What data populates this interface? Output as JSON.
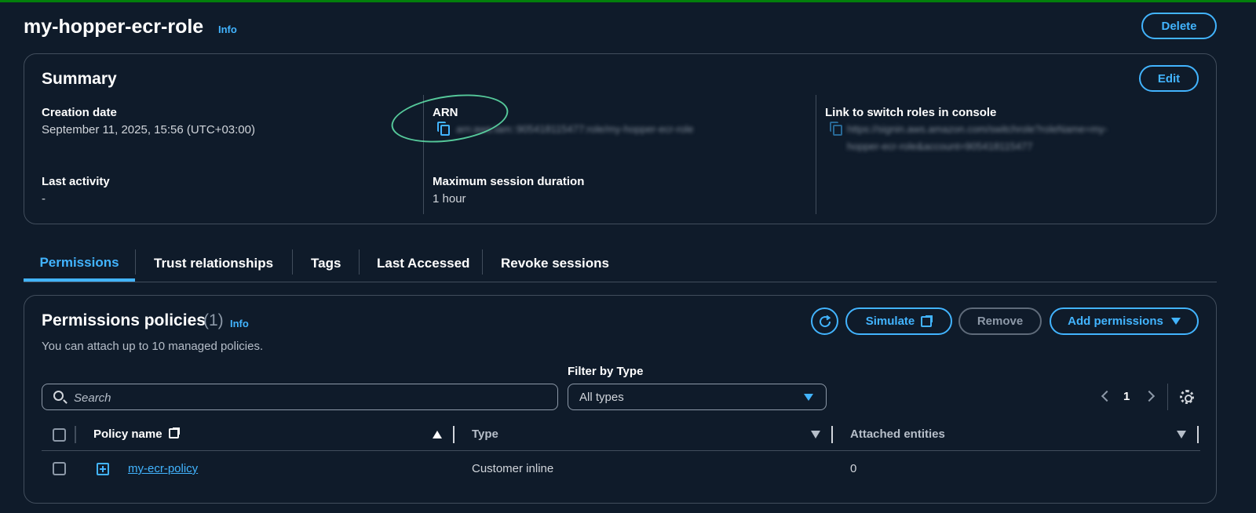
{
  "role": {
    "name": "my-hopper-ecr-role",
    "info": "Info",
    "delete_label": "Delete"
  },
  "summary": {
    "title": "Summary",
    "edit_label": "Edit",
    "creation_date_label": "Creation date",
    "creation_date_value": "September 11, 2025, 15:56 (UTC+03:00)",
    "last_activity_label": "Last activity",
    "last_activity_value": "-",
    "arn_label": "ARN",
    "arn_value": "arn:aws:iam::905418115477:role/my-hopper-ecr-role",
    "max_session_label": "Maximum session duration",
    "max_session_value": "1 hour",
    "switch_link_label": "Link to switch roles in console",
    "switch_link_line1": "https://signin.aws.amazon.com/switchrole?roleName=my-",
    "switch_link_line2": "hopper-ecr-role&account=905418115477"
  },
  "tabs": [
    {
      "label": "Permissions"
    },
    {
      "label": "Trust relationships"
    },
    {
      "label": "Tags"
    },
    {
      "label": "Last Accessed"
    },
    {
      "label": "Revoke sessions"
    }
  ],
  "policies": {
    "title": "Permissions policies",
    "count": "(1)",
    "info": "Info",
    "description": "You can attach up to 10 managed policies.",
    "simulate_label": "Simulate",
    "remove_label": "Remove",
    "add_permissions_label": "Add permissions",
    "filter_label": "Filter by Type",
    "search_placeholder": "Search",
    "filter_value": "All types",
    "page": "1",
    "columns": [
      "Policy name",
      "Type",
      "Attached entities"
    ],
    "rows": [
      {
        "name": "my-ecr-policy",
        "type": "Customer inline",
        "attached": "0"
      }
    ]
  },
  "colors": {
    "accent": "#42b4ff",
    "background": "#0f1b2a",
    "success_bar": "#037f0c",
    "annotation": "#5ddca6"
  },
  "icons": [
    "info-link",
    "copy-icon",
    "refresh-icon",
    "external-link-icon",
    "caret-down-icon",
    "search-icon",
    "chevron-left-icon",
    "chevron-right-icon",
    "gear-icon",
    "sort-ascending-icon",
    "sort-icon",
    "expand-icon"
  ]
}
